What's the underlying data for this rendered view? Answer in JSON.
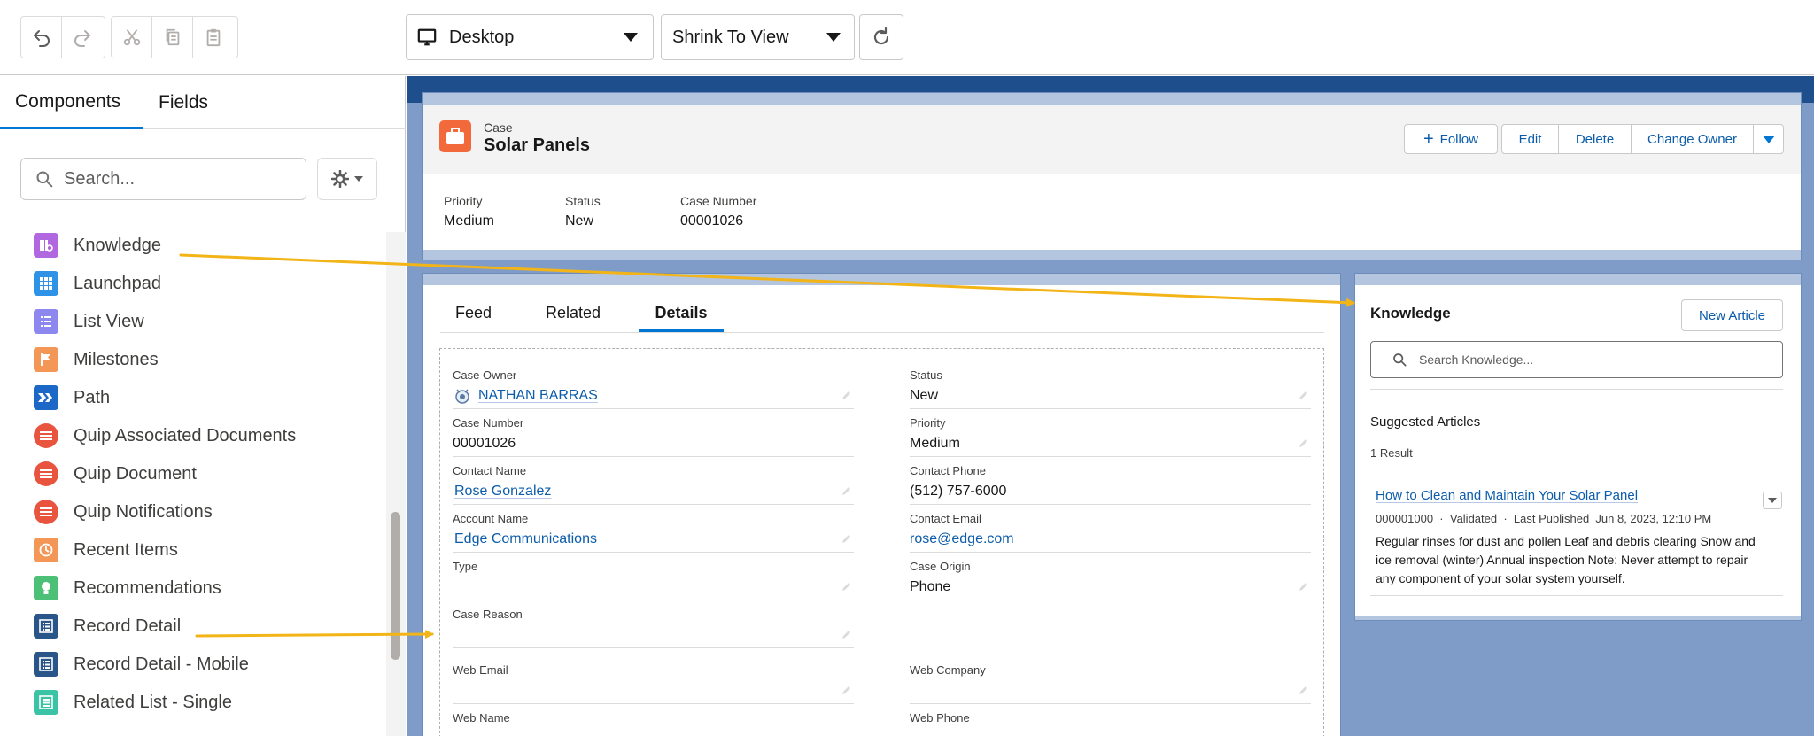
{
  "toolbar": {
    "device_select": "Desktop",
    "zoom_select": "Shrink To View"
  },
  "left_panel": {
    "tabs": [
      {
        "label": "Components"
      },
      {
        "label": "Fields"
      }
    ],
    "search_placeholder": "Search...",
    "components": [
      {
        "label": "Knowledge",
        "color": "#b067e0",
        "icon": "knowledge-icon"
      },
      {
        "label": "Launchpad",
        "color": "#2e93e6",
        "icon": "launchpad-icon"
      },
      {
        "label": "List View",
        "color": "#8d88f0",
        "icon": "list-view-icon"
      },
      {
        "label": "Milestones",
        "color": "#f49756",
        "icon": "milestones-icon"
      },
      {
        "label": "Path",
        "color": "#1b68c6",
        "icon": "path-icon"
      },
      {
        "label": "Quip Associated Documents",
        "color": "#e8543e",
        "icon": "quip-icon"
      },
      {
        "label": "Quip Document",
        "color": "#e8543e",
        "icon": "quip-icon"
      },
      {
        "label": "Quip Notifications",
        "color": "#e8543e",
        "icon": "quip-icon"
      },
      {
        "label": "Recent Items",
        "color": "#f49756",
        "icon": "clock-icon"
      },
      {
        "label": "Recommendations",
        "color": "#4bc076",
        "icon": "lightbulb-icon"
      },
      {
        "label": "Record Detail",
        "color": "#295589",
        "icon": "record-detail-icon"
      },
      {
        "label": "Record Detail - Mobile",
        "color": "#295589",
        "icon": "record-detail-icon"
      },
      {
        "label": "Related List - Single",
        "color": "#3bc3a6",
        "icon": "related-list-icon"
      }
    ]
  },
  "record": {
    "object_label": "Case",
    "title": "Solar Panels",
    "buttons": {
      "follow": "Follow",
      "edit": "Edit",
      "delete": "Delete",
      "change_owner": "Change Owner"
    },
    "highlights": [
      {
        "label": "Priority",
        "value": "Medium"
      },
      {
        "label": "Status",
        "value": "New"
      },
      {
        "label": "Case Number",
        "value": "00001026"
      }
    ]
  },
  "detail_tabs": [
    {
      "label": "Feed"
    },
    {
      "label": "Related"
    },
    {
      "label": "Details"
    }
  ],
  "fields": {
    "case_owner": {
      "label": "Case Owner",
      "value": "NATHAN BARRAS"
    },
    "status": {
      "label": "Status",
      "value": "New"
    },
    "case_number": {
      "label": "Case Number",
      "value": "00001026"
    },
    "priority": {
      "label": "Priority",
      "value": "Medium"
    },
    "contact_name": {
      "label": "Contact Name",
      "value": "Rose Gonzalez"
    },
    "contact_phone": {
      "label": "Contact Phone",
      "value": "(512) 757-6000"
    },
    "account_name": {
      "label": "Account Name",
      "value": "Edge Communications"
    },
    "contact_email": {
      "label": "Contact Email",
      "value": "rose@edge.com"
    },
    "type": {
      "label": "Type",
      "value": ""
    },
    "case_origin": {
      "label": "Case Origin",
      "value": "Phone"
    },
    "case_reason": {
      "label": "Case Reason",
      "value": ""
    },
    "web_email": {
      "label": "Web Email",
      "value": ""
    },
    "web_company": {
      "label": "Web Company",
      "value": ""
    },
    "web_name": {
      "label": "Web Name",
      "value": ""
    },
    "web_phone": {
      "label": "Web Phone",
      "value": ""
    }
  },
  "knowledge": {
    "title": "Knowledge",
    "new_article": "New Article",
    "search_placeholder": "Search Knowledge...",
    "suggested_label": "Suggested Articles",
    "result_count": "1 Result",
    "article": {
      "title": "How to Clean and Maintain Your Solar Panel",
      "number": "000001000",
      "status": "Validated",
      "published": "Last Published  Jun 8, 2023, 12:10 PM",
      "summary": "Regular rinses for dust and pollen Leaf and debris clearing Snow and ice removal (winter) Annual inspection Note: Never attempt to repair any component of your solar system yourself."
    }
  },
  "colors": {
    "brand": "#0176d3",
    "link": "#0b5cab",
    "case_icon": "#f26a3c",
    "canvas_band": "#1f4e8c",
    "arrow": "#f2b416"
  }
}
